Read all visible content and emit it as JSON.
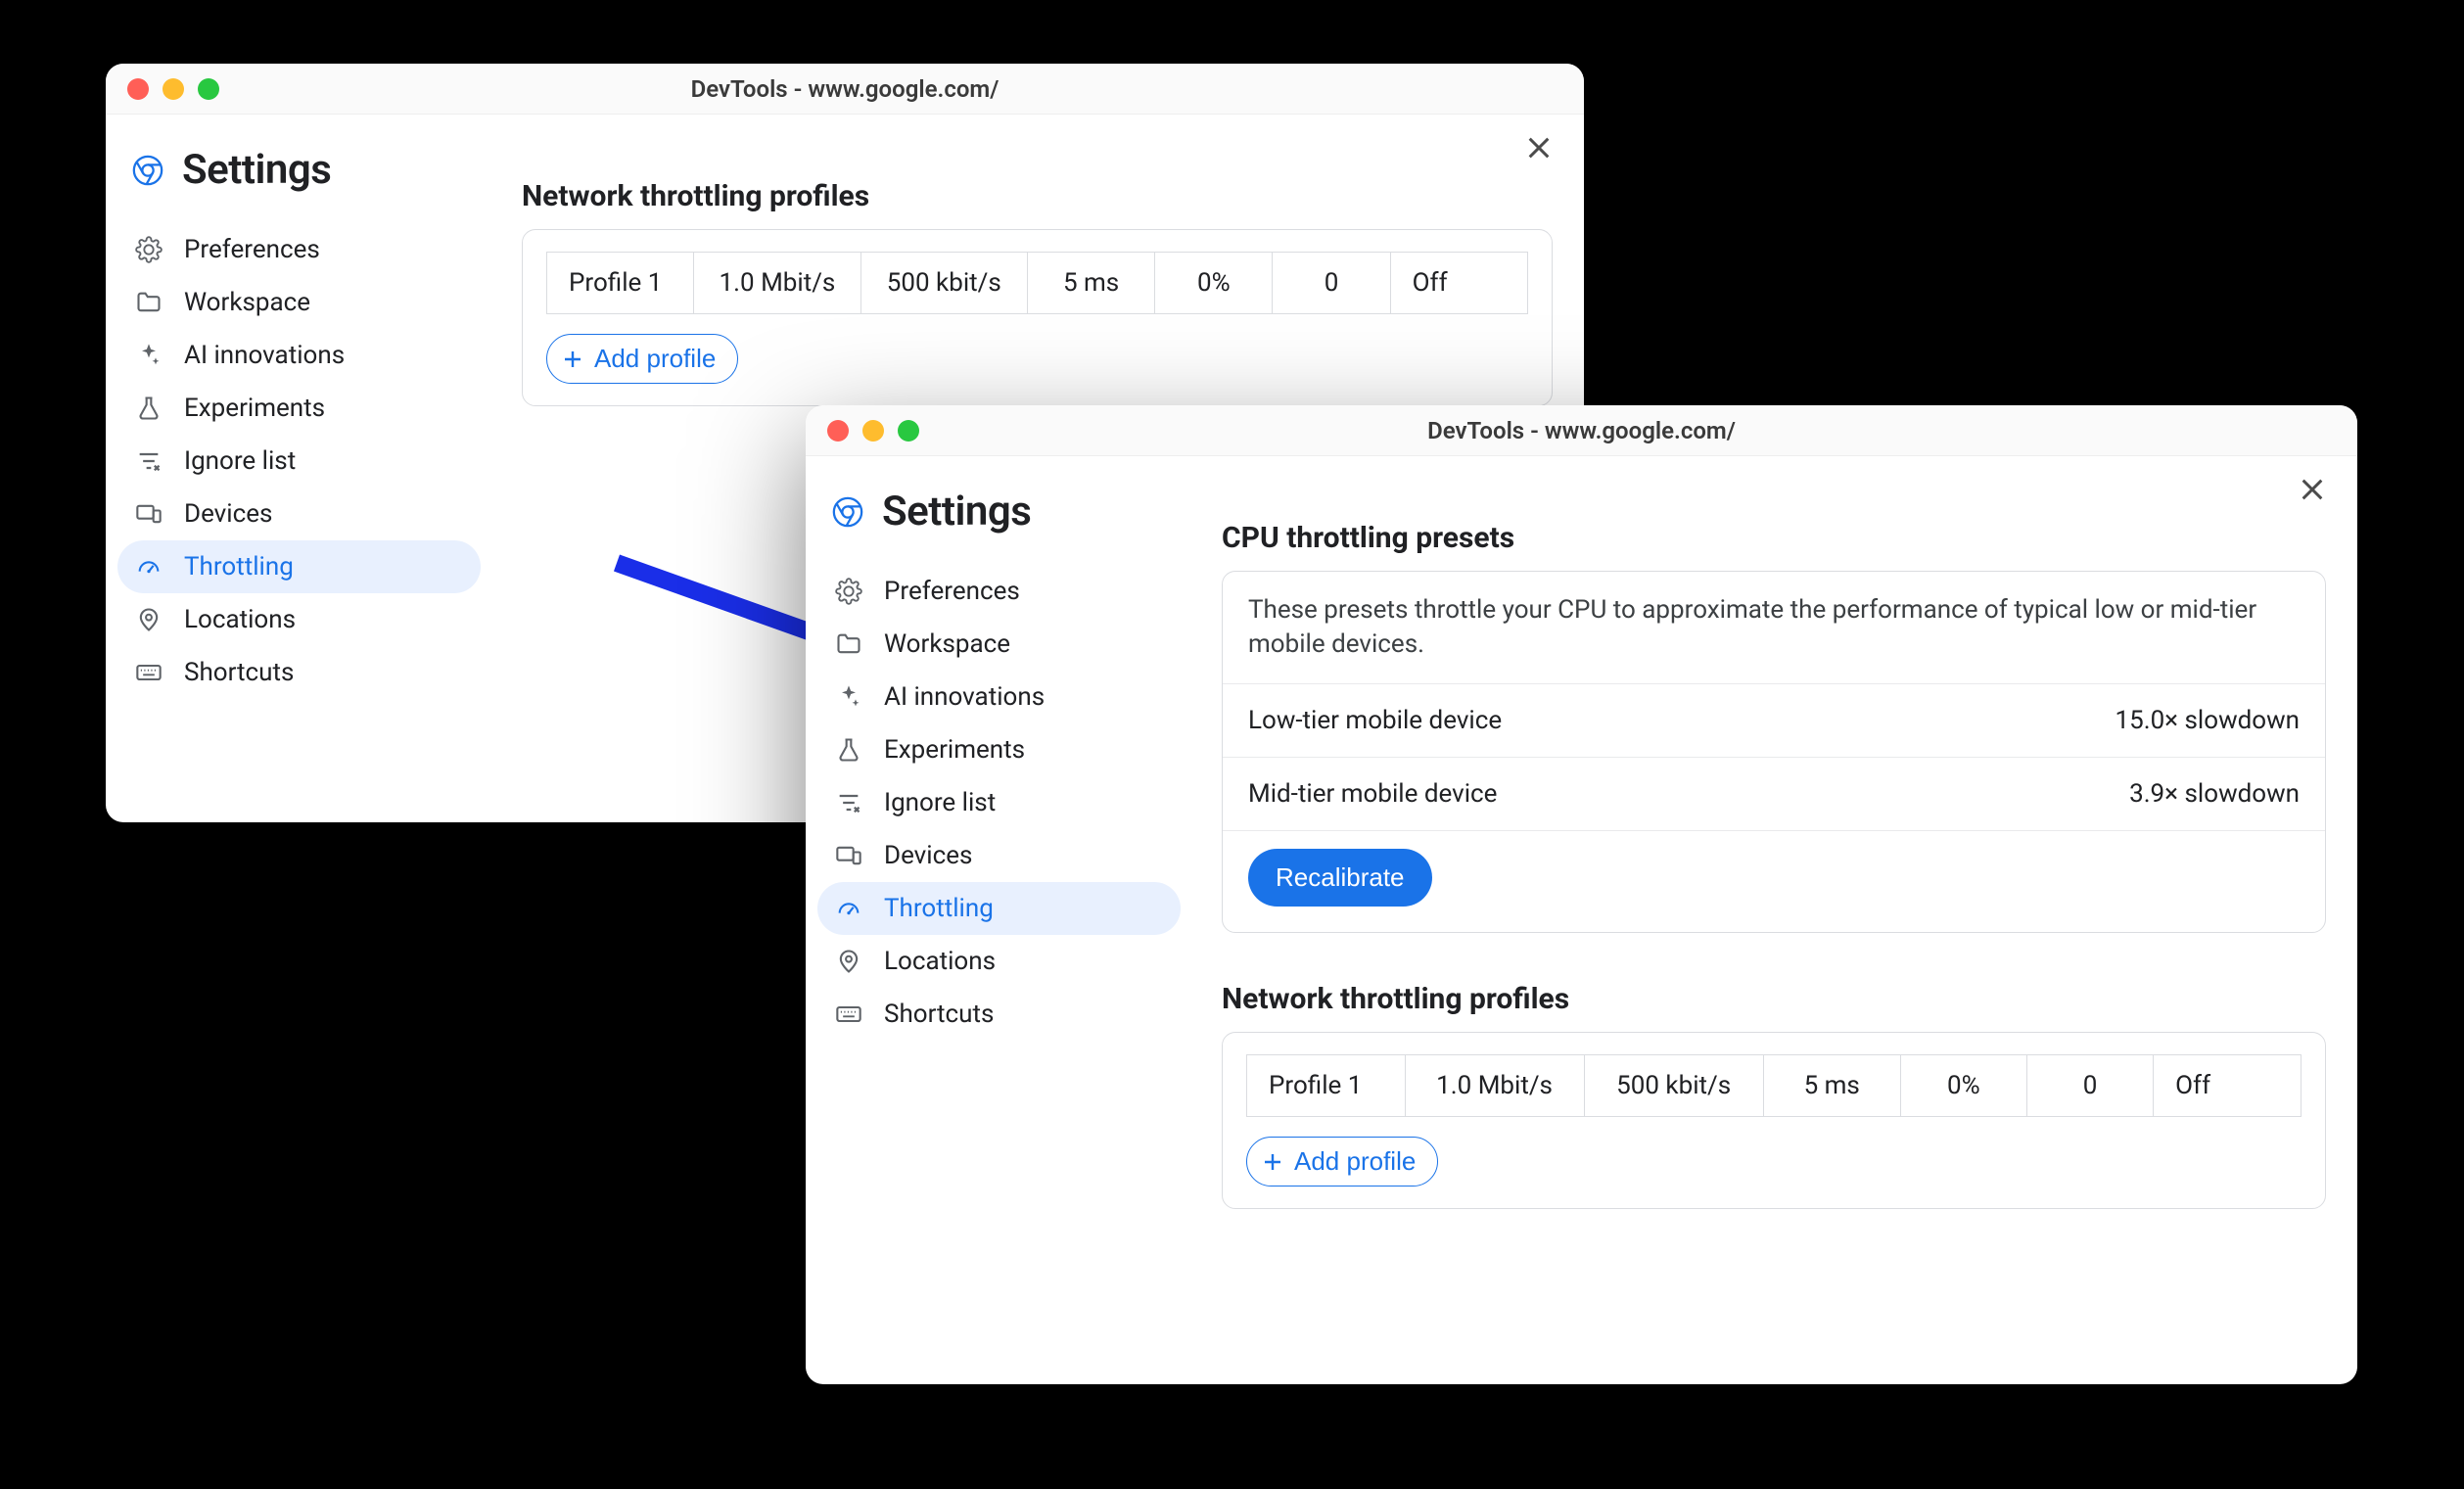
{
  "shared": {
    "window_title": "DevTools - www.google.com/",
    "settings_title": "Settings",
    "sidebar_items": [
      {
        "id": "preferences",
        "label": "Preferences",
        "icon": "gear"
      },
      {
        "id": "workspace",
        "label": "Workspace",
        "icon": "folder"
      },
      {
        "id": "ai",
        "label": "AI innovations",
        "icon": "sparkle"
      },
      {
        "id": "experiments",
        "label": "Experiments",
        "icon": "flask"
      },
      {
        "id": "ignore",
        "label": "Ignore list",
        "icon": "filterx"
      },
      {
        "id": "devices",
        "label": "Devices",
        "icon": "devices"
      },
      {
        "id": "throttling",
        "label": "Throttling",
        "icon": "gauge"
      },
      {
        "id": "locations",
        "label": "Locations",
        "icon": "pin"
      },
      {
        "id": "shortcuts",
        "label": "Shortcuts",
        "icon": "keyboard"
      }
    ],
    "network_section_title": "Network throttling profiles",
    "add_profile_label": "Add profile",
    "profile_row": {
      "name": "Profile 1",
      "download": "1.0 Mbit/s",
      "upload": "500 kbit/s",
      "latency": "5 ms",
      "loss": "0%",
      "queue": "0",
      "state": "Off"
    }
  },
  "window_b": {
    "cpu_section_title": "CPU throttling presets",
    "cpu_description": "These presets throttle your CPU to approximate the performance of typical low or mid-tier mobile devices.",
    "presets": [
      {
        "name": "Low-tier mobile device",
        "value": "15.0× slowdown"
      },
      {
        "name": "Mid-tier mobile device",
        "value": "3.9× slowdown"
      }
    ],
    "recalibrate_label": "Recalibrate"
  },
  "colors": {
    "accent": "#1a73e8",
    "sidebar_active_bg": "#e8f0fe",
    "arrow": "#1A2EE8"
  }
}
